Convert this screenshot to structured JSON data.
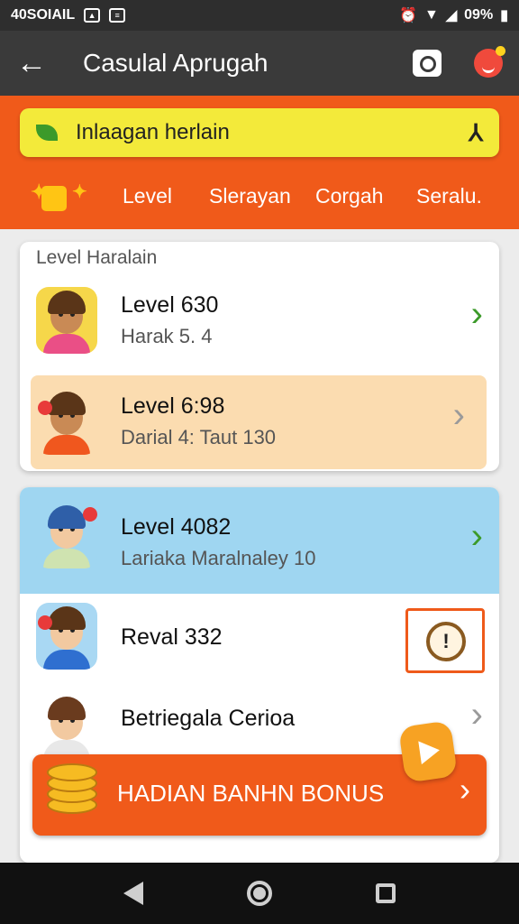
{
  "status_bar": {
    "left_text": "40SOIAIL",
    "battery": "09%"
  },
  "app_bar": {
    "title": "Casulal Aprugah"
  },
  "search": {
    "text": "Inlaagan herlain"
  },
  "nav": {
    "items": [
      "Level",
      "Slerayan",
      "Corgah",
      "Seralu."
    ]
  },
  "section": {
    "title": "Level Haralain"
  },
  "rows": [
    {
      "title": "Level 630",
      "subtitle": "Harak 5. 4"
    },
    {
      "title": "Level 6:98",
      "subtitle": "Darial 4: Taut 130"
    },
    {
      "title": "Level 4082",
      "subtitle": "Lariaka Maralnaley 10"
    },
    {
      "title": "Reval 332",
      "subtitle": ""
    },
    {
      "title": "Betriegala Cerioa",
      "subtitle": ""
    }
  ],
  "bonus": {
    "label": "HADIAN BANHN BONUS"
  },
  "colors": {
    "orange": "#f05a1a",
    "yellow": "#f3ea3a",
    "highlight_row": "#fbdcb0",
    "blue_row": "#9fd6f1",
    "chevron_green": "#3c9a2a"
  }
}
